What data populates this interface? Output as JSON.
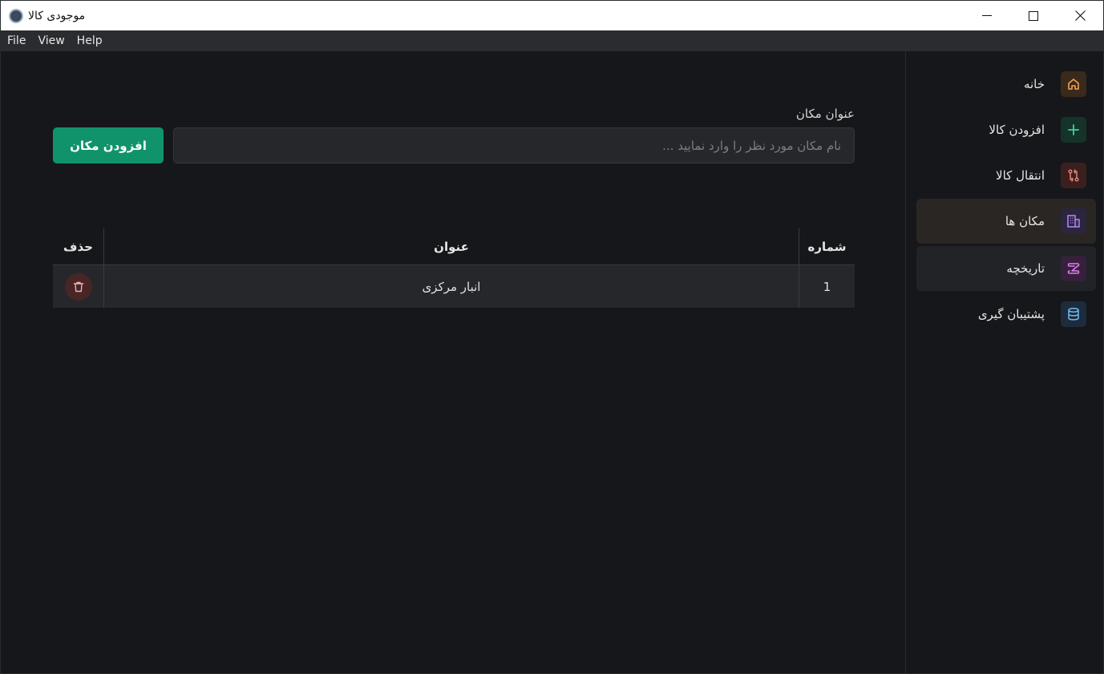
{
  "window": {
    "title": "موجودی کالا",
    "controls": {
      "minimize": "—",
      "maximize": "☐",
      "close": "✕"
    }
  },
  "menubar": {
    "items": [
      "File",
      "View",
      "Help"
    ]
  },
  "sidebar": {
    "items": [
      {
        "label": "خانه",
        "icon": "home-icon",
        "color": "#f0a352",
        "bg": "#3a2a1c"
      },
      {
        "label": "افزودن کالا",
        "icon": "plus-icon",
        "color": "#3fd39a",
        "bg": "#153328"
      },
      {
        "label": "انتقال کالا",
        "icon": "transfer-icon",
        "color": "#f0857a",
        "bg": "#3b1f1f"
      },
      {
        "label": "مکان ها",
        "icon": "building-icon",
        "color": "#b48cf5",
        "bg": "#2c2540",
        "active": true
      },
      {
        "label": "تاریخچه",
        "icon": "history-icon",
        "color": "#e07cf0",
        "bg": "#37203c"
      },
      {
        "label": "پشتیبان گیری",
        "icon": "database-icon",
        "color": "#6fb8f0",
        "bg": "#1d2c3c"
      }
    ]
  },
  "form": {
    "label": "عنوان مکان",
    "placeholder": "نام مکان مورد نظر را وارد نمایید ...",
    "value": "",
    "add_label": "افزودن مکان"
  },
  "table": {
    "headers": {
      "number": "شماره",
      "title": "عنوان",
      "delete": "حذف"
    },
    "rows": [
      {
        "number": "1",
        "title": "انبار مرکزی"
      }
    ]
  }
}
